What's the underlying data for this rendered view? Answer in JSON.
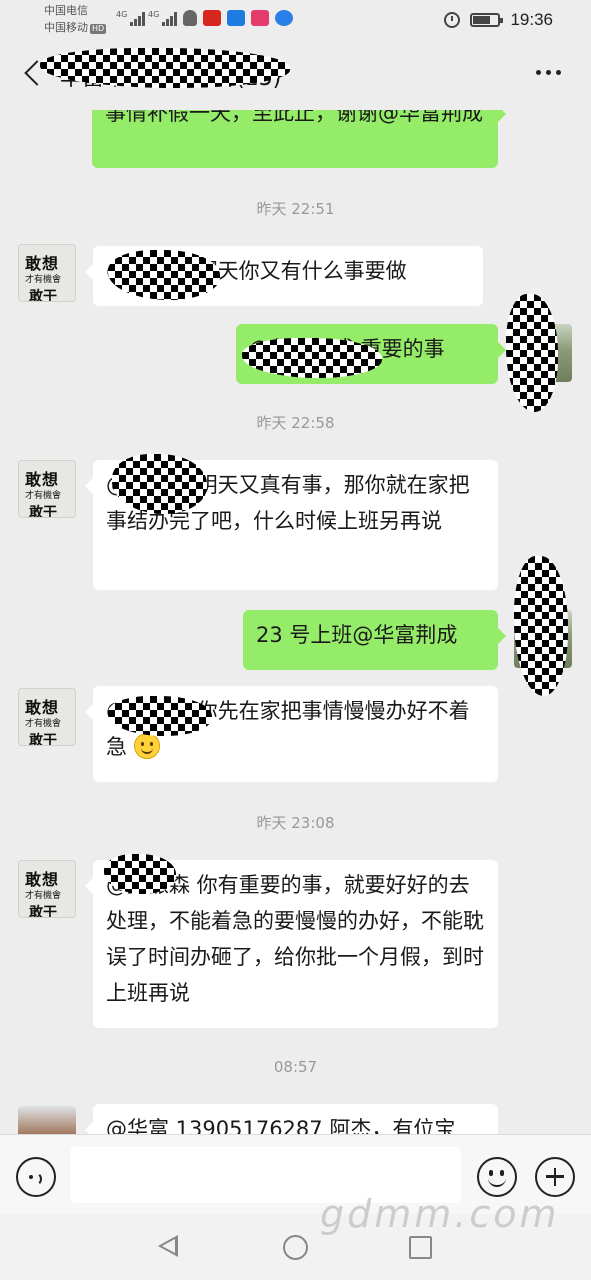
{
  "status_bar": {
    "carrier_1": "中国电信",
    "carrier_2": "中国移动",
    "hd": "HD",
    "net_1": "4G",
    "net_2": "4G",
    "time": "19:36"
  },
  "header": {
    "title": "华富丰劳动工作群(15)"
  },
  "messages": [
    {
      "type": "bubble",
      "side": "right",
      "text": "事情补假一天，至此止，谢谢@华富荆成"
    },
    {
      "type": "time",
      "text": "昨天 22:51"
    },
    {
      "type": "bubble",
      "side": "left",
      "text": "@吴振森 明天你又有什么事要做"
    },
    {
      "type": "bubble",
      "side": "right",
      "text": "@华富荆成 重要的事"
    },
    {
      "type": "time",
      "text": "昨天 22:58"
    },
    {
      "type": "bubble",
      "side": "left",
      "text": "@吴振森 明天又真有事，那你就在家把事结办完了吧，什么时候上班另再说"
    },
    {
      "type": "bubble",
      "side": "right",
      "text": "23 号上班@华富荆成"
    },
    {
      "type": "bubble",
      "side": "left",
      "text": "@吴振森 你先在家把事情慢慢办好不着急"
    },
    {
      "type": "time",
      "text": "昨天 23:08"
    },
    {
      "type": "bubble",
      "side": "left",
      "text": "@吴振森 你有重要的事，就要好好的去处理，不能着急的要慢慢的办好，不能耽误了时间办砸了，给你批一个月假，到时上班再说"
    },
    {
      "type": "time",
      "text": "08:57"
    },
    {
      "type": "bubble",
      "side": "left",
      "text": "@华富 13905176287 阿杰，有位宝"
    }
  ],
  "avatar_text": {
    "line1": "敢想",
    "line2": "才有機會",
    "line3": "敢干"
  },
  "input_bar": {
    "placeholder": ""
  },
  "watermark": "gdmm.com",
  "colors": {
    "bg": "#ededed",
    "bubble_right": "#95ec69",
    "bubble_left": "#ffffff",
    "link": "#3a6ea8"
  },
  "icons": [
    "back-icon",
    "more-icon",
    "voice-icon",
    "emoji-icon",
    "plus-icon",
    "alarm-icon",
    "battery-icon"
  ]
}
